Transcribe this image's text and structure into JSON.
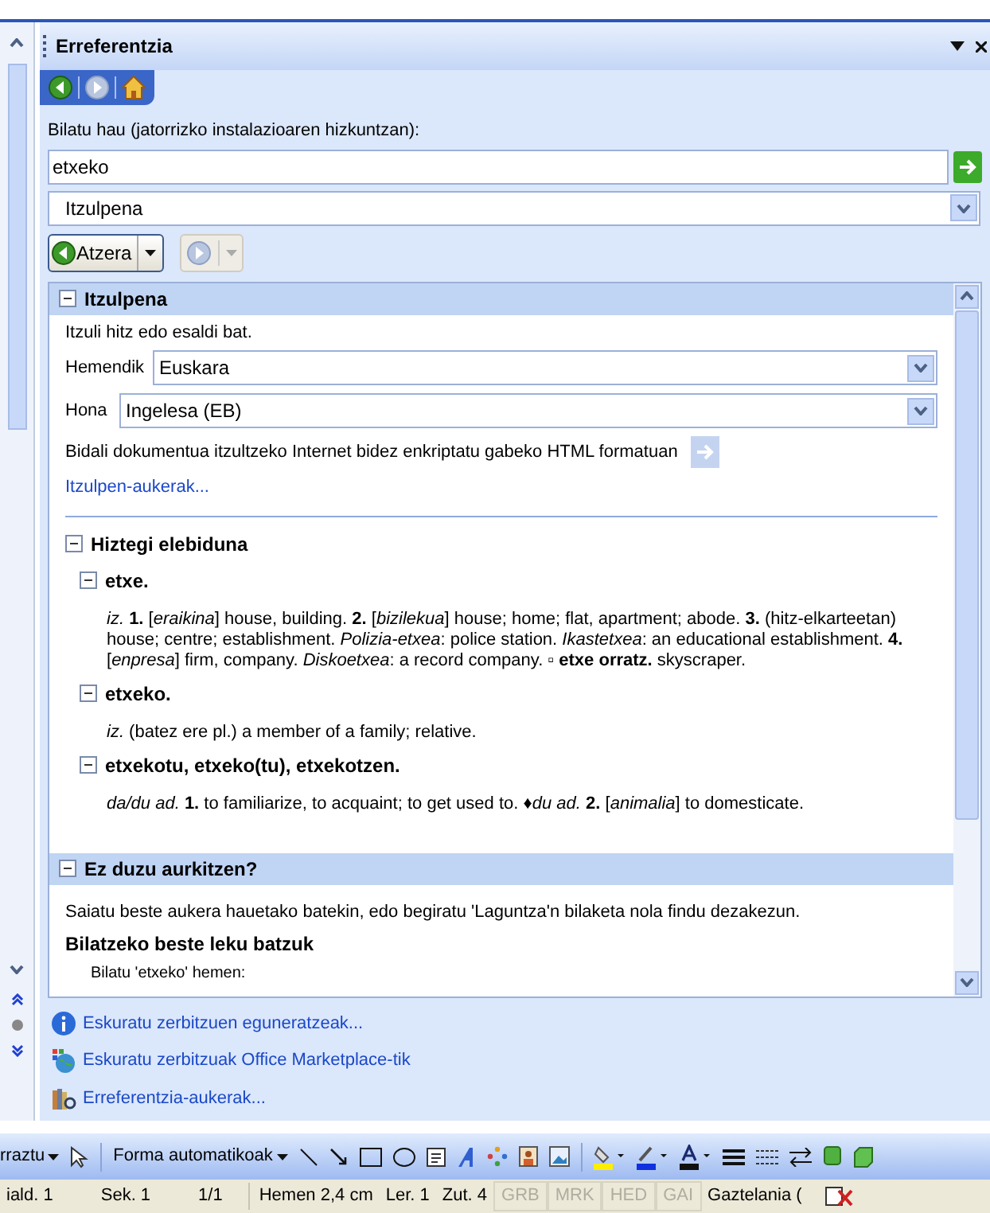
{
  "pane": {
    "title": "Erreferentzia",
    "nav": [
      {
        "kind": "back",
        "disabled": false
      },
      {
        "kind": "forward",
        "disabled": true
      },
      {
        "kind": "home",
        "disabled": false
      }
    ]
  },
  "search": {
    "label": "Bilatu hau (jatorrizko instalazioaren hizkuntzan):",
    "value": "etxeko",
    "service": "Itzulpena"
  },
  "history": {
    "back": "Atzera",
    "forward_disabled": true
  },
  "translation": {
    "header": "Itzulpena",
    "expanded": true,
    "intro": "Itzuli hitz edo esaldi bat.",
    "from_label": "Hemendik",
    "from": "Euskara",
    "to_label": "Hona",
    "to": "Ingelesa (EB)",
    "send": "Bidali dokumentua itzultzeko Internet bidez enkriptatu gabeko HTML formatuan",
    "options": "Itzulpen-aukerak...",
    "dictionary": {
      "title": "Hiztegi elebiduna",
      "expanded": true,
      "entries": [
        {
          "head": "etxe.",
          "expanded": true,
          "text": "*iz.* **1.** [*eraikina*] house, building. **2.** [*bizilekua*] house; home; flat, apartment; abode. **3.** (hitz-elkarteetan) house; centre; establishment. *Polizia-etxea*: police station. *Ikastetxea*: an educational establishment. **4.** [*enpresa*] firm, company. *Diskoetxea*: a record company. ▫ **etxe orratz.** skyscraper."
        },
        {
          "head": "etxeko.",
          "expanded": true,
          "text": "*iz.* (batez ere pl.) a member of a family; relative."
        },
        {
          "head": "etxekotu, etxeko(tu), etxekotzen.",
          "expanded": true,
          "text": "*da/du ad.* **1.** to familiarize, to acquaint; to get used to.  ♦*du ad.* **2.** [*animalia*] to domesticate."
        }
      ]
    }
  },
  "not_found": {
    "header": "Ez duzu aurkitzen?",
    "expanded": true,
    "text": "Saiatu beste aukera hauetako batekin, edo begiratu 'Laguntza'n bilaketa nola findu dezakezun.",
    "subtitle": "Bilatzeko beste leku batzuk",
    "cut_line": "Bilatu 'etxeko' hemen:"
  },
  "links": [
    {
      "kind": "info",
      "label": "Eskuratu zerbitzuen eguneratzeak..."
    },
    {
      "kind": "market",
      "label": "Eskuratu zerbitzuak Office Marketplace-tik"
    },
    {
      "kind": "options",
      "label": "Erreferentzia-aukerak..."
    }
  ],
  "toolbar": {
    "draw": "rraztu",
    "autoshapes": "Forma automatikoak"
  },
  "status": [
    {
      "text": "iald. 1",
      "disabled": false
    },
    {
      "text": "Sek. 1",
      "disabled": false
    },
    {
      "text": "1/1",
      "disabled": false
    },
    {
      "text": "Hemen 2,4 cm",
      "disabled": false
    },
    {
      "text": "Ler. 1",
      "disabled": false
    },
    {
      "text": "Zut. 4",
      "disabled": false
    },
    {
      "text": "GRB",
      "disabled": true
    },
    {
      "text": "MRK",
      "disabled": true
    },
    {
      "text": "HED",
      "disabled": true
    },
    {
      "text": "GAI",
      "disabled": true
    },
    {
      "text": "Gaztelania (",
      "disabled": false
    }
  ]
}
